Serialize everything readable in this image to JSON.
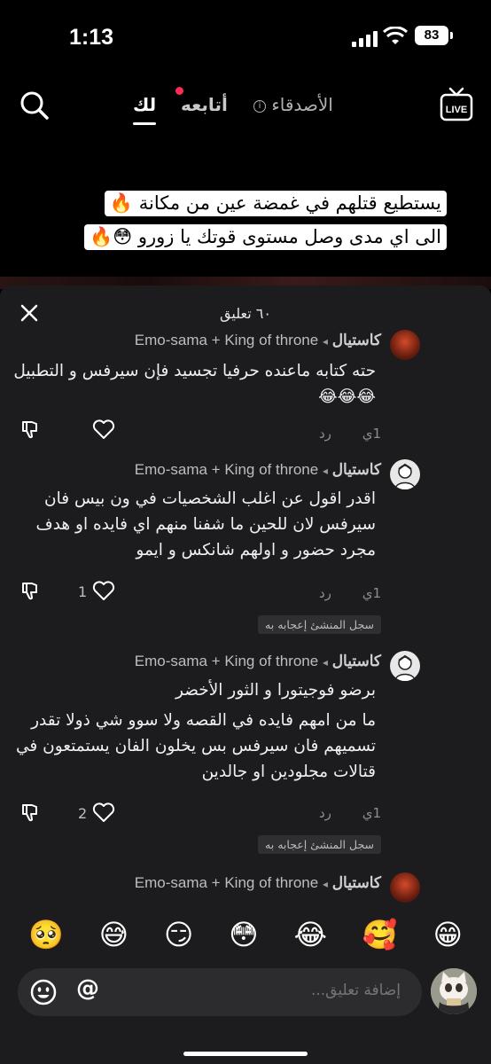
{
  "status_bar": {
    "time": "1:13",
    "battery": "83"
  },
  "nav": {
    "tab_for_you": "لك",
    "tab_following": "أتابعه",
    "tab_friends": "الأصدقاء",
    "live_label": "LIVE"
  },
  "caption": {
    "line1": "يستطيع قتلهم في غمضة عين من مكانة 🔥",
    "line2": "الى اي مدى وصل مستوى قوتك يا زورو 😳🔥"
  },
  "comments_sheet": {
    "title": "٦٠ تعليق",
    "comments": [
      {
        "author": "كاستيال",
        "reply_to": "Emo-sama + King of throne",
        "body": "حته كتابه ماعنده حرفيا تجسيد فإن سيرفس و التطبيل 😂😂😂",
        "time": "1ي",
        "reply_label": "رد",
        "likes": ""
      },
      {
        "author": "كاستيال",
        "reply_to": "Emo-sama + King of throne",
        "body": "اقدر اقول عن اغلب الشخصيات في ون بيس فان سيرفس لان للحين ما شفنا منهم اي فايده او هدف مجرد حضور و اولهم شانكس و ايمو",
        "time": "1ي",
        "reply_label": "رد",
        "likes": "1",
        "creator_badge": "سجل المنشئ إعجابه به"
      },
      {
        "author": "كاستيال",
        "reply_to": "Emo-sama + King of throne",
        "body_lines": [
          "برضو فوجيتورا و الثور الأخضر",
          "ما من امهم فايده في القصه ولا سوو شي ذولا تقدر تسميهم فان سيرفس بس يخلون الفان يستمتعون في قتالات مجلودين او جالدين"
        ],
        "time": "1ي",
        "reply_label": "رد",
        "likes": "2",
        "creator_badge": "سجل المنشئ إعجابه به"
      },
      {
        "author": "كاستيال",
        "reply_to": "Emo-sama + King of throne"
      }
    ]
  },
  "emoji_bar": [
    "🥺",
    "😅",
    "😏",
    "😳",
    "😂",
    "🥰",
    "😁"
  ],
  "input": {
    "placeholder": "إضافة تعليق..."
  }
}
